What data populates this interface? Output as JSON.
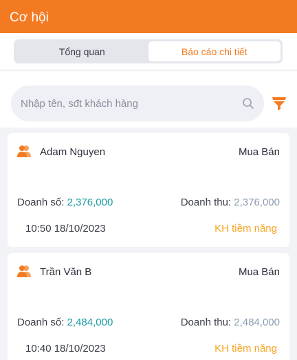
{
  "header": {
    "title": "Cơ hội"
  },
  "tabs": [
    {
      "label": "Tổng quan",
      "active": false
    },
    {
      "label": "Báo cáo chi tiết",
      "active": true
    }
  ],
  "search": {
    "placeholder": "Nhập tên, sđt khách hàng",
    "value": ""
  },
  "icons": {
    "search": "search-icon",
    "filter": "filter-icon",
    "person": "person-icon"
  },
  "colors": {
    "brand": "#f47a22",
    "revenue": "#1b9aa3",
    "income": "#8a9bb0",
    "status": "#f6a623"
  },
  "cards": [
    {
      "name": "Adam Nguyen",
      "type": "Mua Bán",
      "doanh_so_label": "Doanh số:",
      "doanh_so": "2,376,000",
      "doanh_thu_label": "Doanh thu:",
      "doanh_thu": "2,376,000",
      "time": "10:50 18/10/2023",
      "status": "KH tiềm năng"
    },
    {
      "name": "Trần Văn B",
      "type": "Mua Bán",
      "doanh_so_label": "Doanh số:",
      "doanh_so": "2,484,000",
      "doanh_thu_label": "Doanh thu:",
      "doanh_thu": "2,484,000",
      "time": "10:40 18/10/2023",
      "status": "KH tiềm năng"
    }
  ]
}
